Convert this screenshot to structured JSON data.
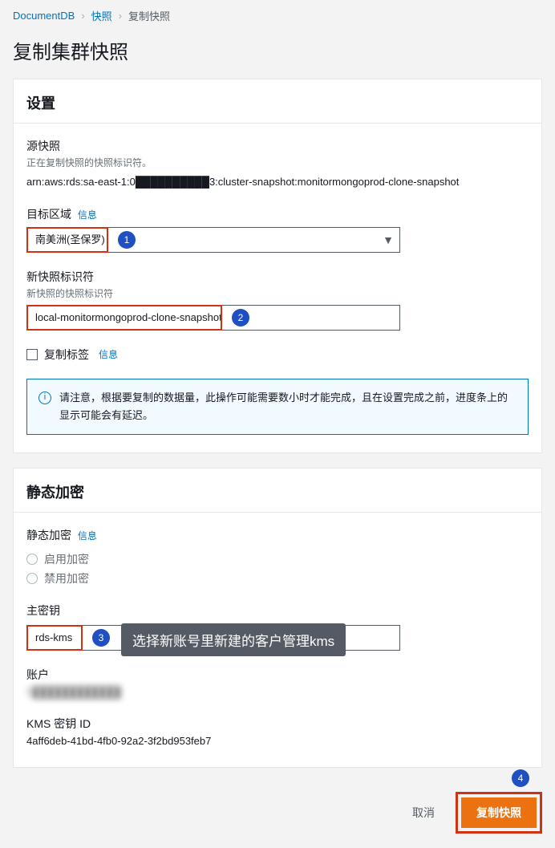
{
  "breadcrumb": {
    "root": "DocumentDB",
    "mid": "快照",
    "current": "复制快照"
  },
  "page_title": "复制集群快照",
  "settings": {
    "title": "设置",
    "source_label": "源快照",
    "source_desc": "正在复制快照的快照标识符。",
    "source_arn": "arn:aws:rds:sa-east-1:0██████████3:cluster-snapshot:monitormongoprod-clone-snapshot",
    "target_region_label": "目标区域",
    "target_region_info": "信息",
    "target_region_value": "南美洲(圣保罗)",
    "new_snapshot_label": "新快照标识符",
    "new_snapshot_desc": "新快照的快照标识符",
    "new_snapshot_value": "local-monitormongoprod-clone-snapshot",
    "copy_tags_label": "复制标签",
    "copy_tags_info": "信息",
    "alert_text": "请注意，根据要复制的数据量，此操作可能需要数小时才能完成，且在设置完成之前，进度条上的显示可能会有延迟。"
  },
  "encryption": {
    "title": "静态加密",
    "label": "静态加密",
    "info": "信息",
    "option_enable": "启用加密",
    "option_disable": "禁用加密",
    "master_key_label": "主密钥",
    "master_key_value": "rds-kms",
    "tooltip": "选择新账号里新建的客户管理kms",
    "account_label": "账户",
    "account_value": "5████████████",
    "kms_id_label": "KMS 密钥 ID",
    "kms_id_value": "4aff6deb-41bd-4fb0-92a2-3f2bd953feb7"
  },
  "actions": {
    "cancel": "取消",
    "submit": "复制快照"
  },
  "callouts": {
    "c1": "1",
    "c2": "2",
    "c3": "3",
    "c4": "4"
  }
}
